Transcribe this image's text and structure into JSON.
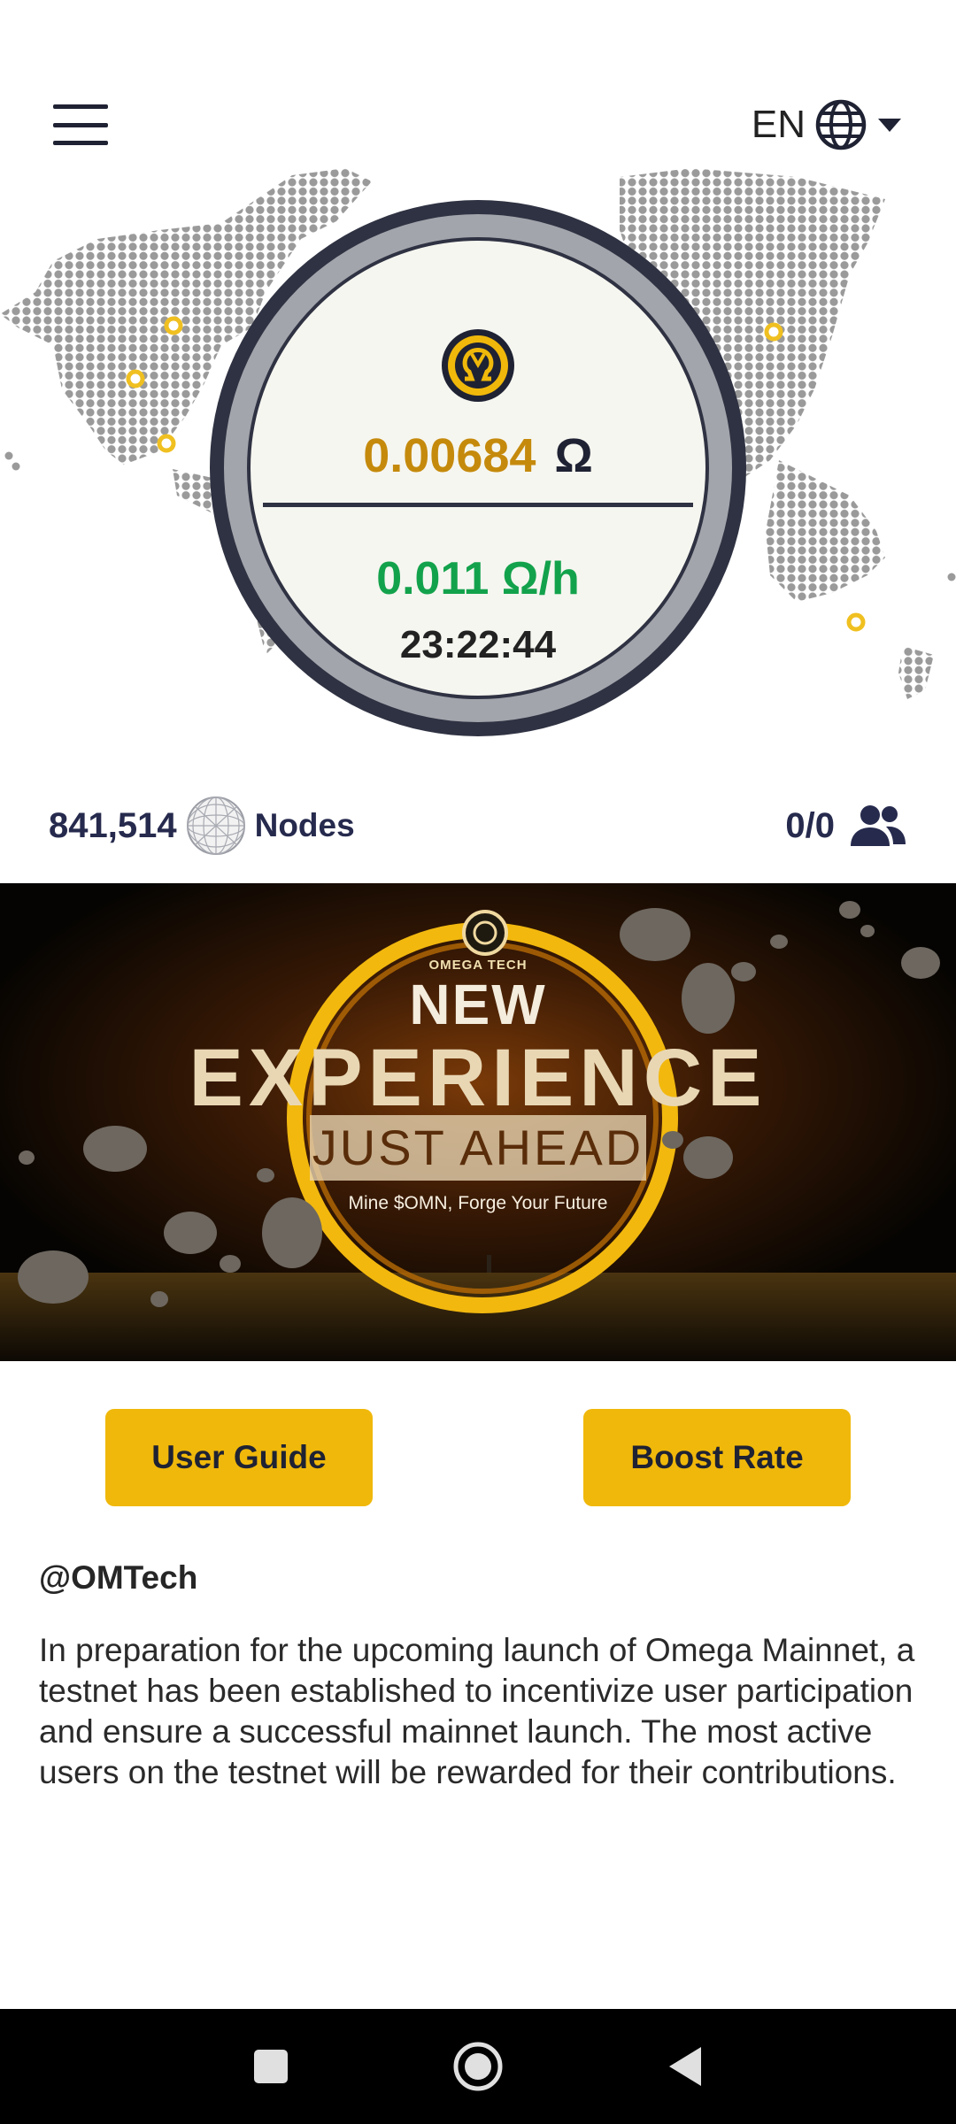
{
  "header": {
    "language": "EN",
    "menu_icon": "hamburger-menu-icon",
    "language_icon": "globe-icon",
    "dropdown_icon": "caret-down-icon"
  },
  "mining": {
    "coin_icon": "omega-coin-icon",
    "balance": "0.00684",
    "currency_symbol": "Ω",
    "rate": "0.011 Ω/h",
    "countdown": "23:22:44"
  },
  "stats": {
    "nodes_count": "841,514",
    "nodes_label": "Nodes",
    "nodes_icon": "network-sphere-icon",
    "referrals": "0/0",
    "referrals_icon": "users-icon"
  },
  "banner": {
    "brand": "OMEGA TECH",
    "headline_1": "NEW",
    "headline_2": "EXPERIENCE",
    "headline_3": "JUST  AHEAD",
    "tagline": "Mine $OMN, Forge Your Future"
  },
  "actions": {
    "user_guide": "User Guide",
    "boost_rate": "Boost Rate"
  },
  "announcement": {
    "handle": "@OMTech",
    "text": "In preparation for the upcoming launch of Omega Mainnet, a testnet has been established to incentivize user participation and ensure a successful mainnet launch. The most active users on the testnet will be rewarded for their contributions."
  },
  "colors": {
    "accent": "#f0b80a",
    "balance": "#c58a0c",
    "rate": "#13a24c",
    "navy": "#262a4d"
  },
  "system_nav": {
    "recents_icon": "square-recents-icon",
    "home_icon": "circle-home-icon",
    "back_icon": "triangle-back-icon"
  }
}
